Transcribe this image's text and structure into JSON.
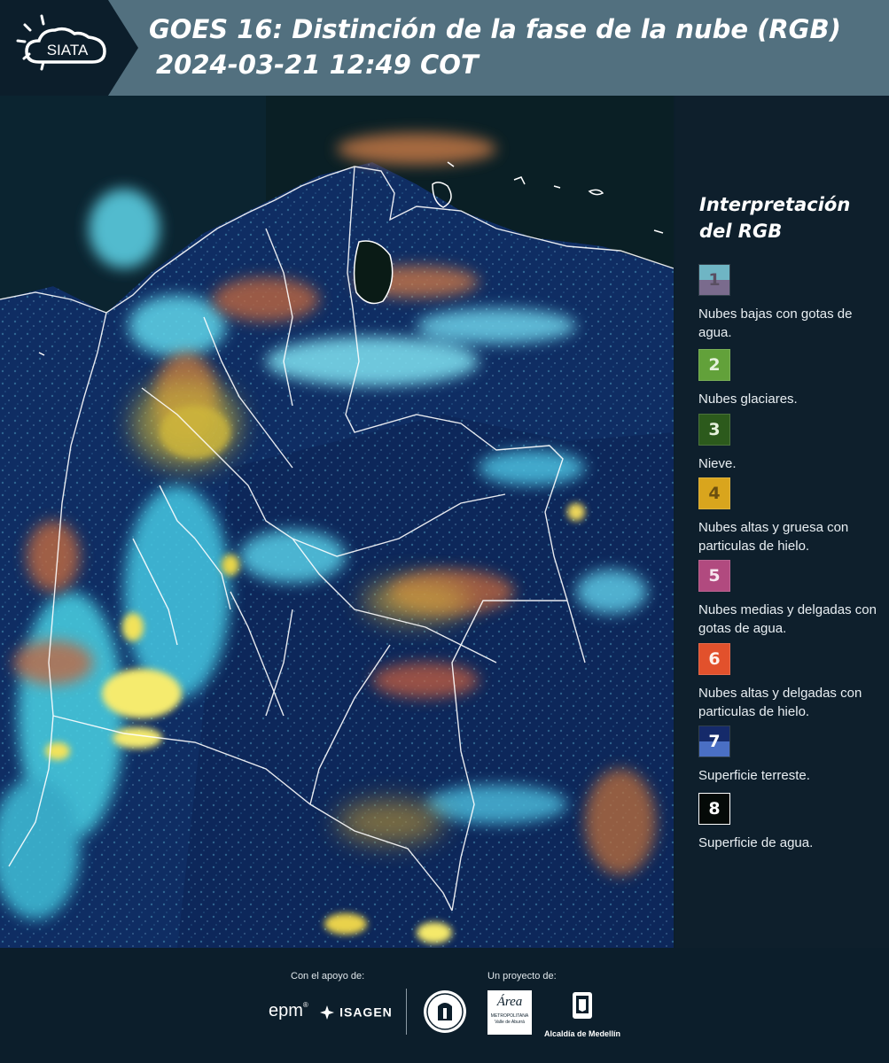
{
  "header": {
    "logo_text": "SIATA",
    "title": "GOES 16: Distinción de la fase de la nube (RGB)",
    "subtitle": "2024-03-21 12:49 COT",
    "background_color": "#52707f",
    "logo_panel_color": "#0c1e2b"
  },
  "legend": {
    "title": "Interpretación del RGB",
    "items": [
      {
        "number": "1",
        "label": "Nubes bajas con gotas de agua.",
        "color_top": "#6fb5c4",
        "color_bottom": "#7a6b8d"
      },
      {
        "number": "2",
        "label": "Nubes glaciares.",
        "color": "#62a13a"
      },
      {
        "number": "3",
        "label": "Nieve.",
        "color": "#2c5a1c"
      },
      {
        "number": "4",
        "label": "Nubes altas y gruesa con particulas de hielo.",
        "color": "#d9a51d"
      },
      {
        "number": "5",
        "label": "Nubes medias y delgadas con gotas de agua.",
        "color": "#b14a7f"
      },
      {
        "number": "6",
        "label": "Nubes altas y delgadas con particulas de hielo.",
        "color": "#e2512c"
      },
      {
        "number": "7",
        "label": "Superficie terreste.",
        "color_top": "#152a6a",
        "color_bottom": "#4a6fc4"
      },
      {
        "number": "8",
        "label": "Superficie de agua.",
        "color": "#050a08"
      }
    ]
  },
  "footer": {
    "support_label": "Con el apoyo de:",
    "project_label": "Un proyecto de:",
    "logos": {
      "epm": "epm",
      "isagen": "ISAGEN",
      "area_name": "Área",
      "area_sub1": "METROPOLITANA",
      "area_sub2": "Valle de Aburrá",
      "alcaldia": "Alcaldía de Medellín"
    }
  },
  "map_colors": {
    "land": "#0f2d63",
    "ocean_pacific": "#0d3a55",
    "ocean_caribbean": "#081a22",
    "cloud_cyan": "#5fd6ea",
    "cloud_yellow": "#f2e25a",
    "cloud_orange": "#d9824a",
    "border": "#ffffff"
  }
}
